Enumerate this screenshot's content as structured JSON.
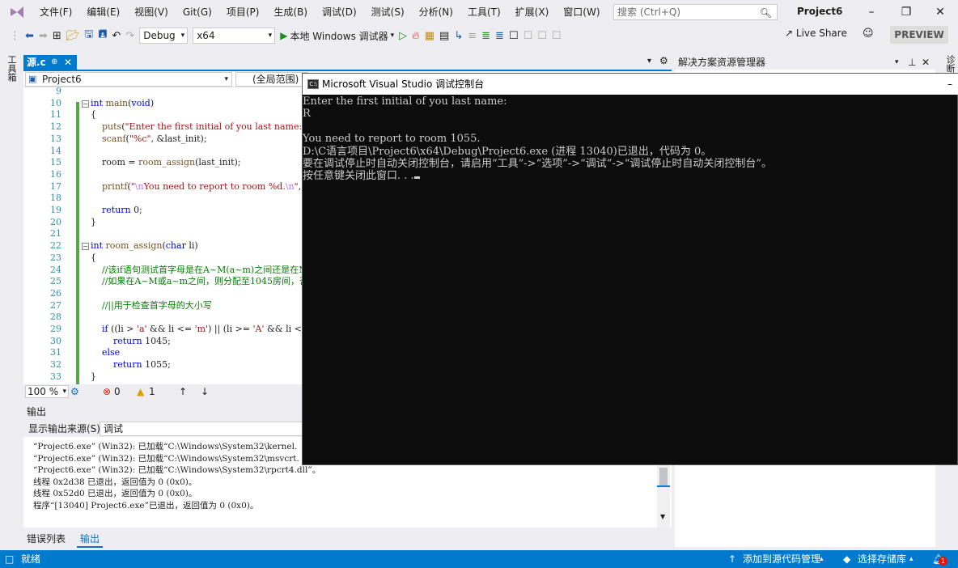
{
  "menubar": {
    "items": [
      "文件(F)",
      "编辑(E)",
      "视图(V)",
      "Git(G)",
      "项目(P)",
      "生成(B)",
      "调试(D)",
      "测试(S)",
      "分析(N)",
      "工具(T)",
      "扩展(X)",
      "窗口(W)",
      "帮助(H)"
    ],
    "search_placeholder": "搜索 (Ctrl+Q)",
    "project_title": "Project6"
  },
  "toolbar": {
    "config": "Debug",
    "platform": "x64",
    "run_label": "本地 Windows 调试器",
    "live_share": "Live Share",
    "preview": "PREVIEW"
  },
  "side_tabs": {
    "left": "工具箱",
    "right": "诊断"
  },
  "editor": {
    "tab_label": "源.c",
    "project_combo": "Project6",
    "scope_combo": "(全局范围)",
    "zoom": "100 %",
    "errors": "0",
    "warnings": "1",
    "line_numbers": [
      "9",
      "10",
      "11",
      "12",
      "13",
      "14",
      "15",
      "16",
      "17",
      "18",
      "19",
      "20",
      "21",
      "22",
      "23",
      "24",
      "25",
      "26",
      "27",
      "28",
      "29",
      "30",
      "31",
      "32",
      "33"
    ],
    "lines": [
      "",
      "int main(void)",
      "{",
      "    puts(\"Enter the first initial of you last name:\");",
      "    scanf(\"%c\", &last_init);",
      "",
      "    room = room_assign(last_init);",
      "",
      "    printf(\"\\nYou need to report to room %d.\\n\", room);",
      "",
      "    return 0;",
      "}",
      "",
      "int room_assign(char li)",
      "{",
      "    //该if语句测试首字母是在A~M(a~m)之间还是在N~Z(n~z)之间",
      "    //如果在A~M或a~m之间，则分配至1045房间，否则分配至1055房间",
      "",
      "    //||用于检查首字母的大小写",
      "",
      "    if ((li > 'a' && li <= 'm') || (li >= 'A' && li <= 'M'))",
      "        return 1045;",
      "    else",
      "        return 1055;",
      "}"
    ]
  },
  "output": {
    "title": "输出",
    "source_label": "显示输出来源(S):",
    "source_value": "调试",
    "lines": [
      "“Project6.exe” (Win32): 已加载“C:\\Windows\\System32\\kernel.",
      "“Project6.exe” (Win32): 已加载“C:\\Windows\\System32\\msvcrt.",
      "“Project6.exe” (Win32): 已加载“C:\\Windows\\System32\\rpcrt4.dll”。",
      "线程 0x2d38 已退出，返回值为 0 (0x0)。",
      "线程 0x52d0 已退出，返回值为 0 (0x0)。",
      "程序“[13040] Project6.exe”已退出，返回值为 0 (0x0)。"
    ],
    "tabs": [
      "错误列表",
      "输出"
    ]
  },
  "solution_explorer": {
    "title": "解决方案资源管理器"
  },
  "console": {
    "title": "Microsoft Visual Studio 调试控制台",
    "icon_text": "C:\\",
    "lines": [
      "Enter the first initial of you last name:",
      "R",
      "",
      "You need to report to room 1055.",
      "D:\\C语言项目\\Project6\\x64\\Debug\\Project6.exe (进程 13040)已退出，代码为 0。",
      "要在调试停止时自动关闭控制台，请启用“工具”->“选项”->“调试”->“调试停止时自动关闭控制台”。",
      "按任意键关闭此窗口. . ."
    ]
  },
  "statusbar": {
    "status": "就绪",
    "add_source": "添加到源代码管理",
    "select_repo": "选择存储库",
    "notifications": "1"
  },
  "colors": {
    "accent": "#007acc",
    "console_bg": "#0c0c0c",
    "console_fg": "#cccccc",
    "keyword": "#0000ff",
    "comment": "#008000"
  }
}
